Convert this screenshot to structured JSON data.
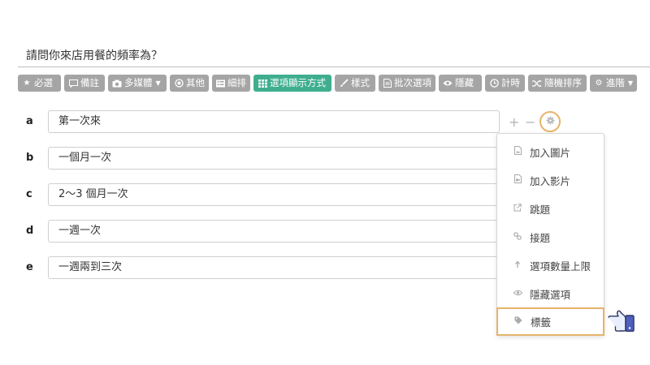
{
  "question": {
    "text": "請問你來店用餐的頻率為？"
  },
  "toolbar": {
    "buttons": [
      {
        "label": "必選",
        "icon": "star-icon"
      },
      {
        "label": "備註",
        "icon": "comment-icon"
      },
      {
        "label": "多媒體",
        "icon": "camera-icon"
      },
      {
        "label": "其他",
        "icon": "radio-icon"
      },
      {
        "label": "細排",
        "icon": "list-icon"
      },
      {
        "label": "選項顯示方式",
        "icon": "grid-icon"
      },
      {
        "label": "樣式",
        "icon": "brush-icon"
      },
      {
        "label": "批次選項",
        "icon": "file-icon"
      },
      {
        "label": "隱藏",
        "icon": "eye-icon"
      },
      {
        "label": "計時",
        "icon": "clock-icon"
      },
      {
        "label": "隨機排序",
        "icon": "shuffle-icon"
      },
      {
        "label": "進階",
        "icon": "gear-icon"
      }
    ],
    "active_color": "#3fae8f",
    "default_color": "#a5a5a5"
  },
  "options": [
    {
      "letter": "a",
      "value": "第一次來"
    },
    {
      "letter": "b",
      "value": "一個月一次"
    },
    {
      "letter": "c",
      "value": "2～3 個月一次"
    },
    {
      "letter": "d",
      "value": "一週一次"
    },
    {
      "letter": "e",
      "value": "一週兩到三次"
    }
  ],
  "row_controls": {
    "plus": "+",
    "minus": "−"
  },
  "dropdown": {
    "items": [
      {
        "label": "加入圖片",
        "icon": "image-file-icon"
      },
      {
        "label": "加入影片",
        "icon": "video-file-icon"
      },
      {
        "label": "跳題",
        "icon": "external-link-icon"
      },
      {
        "label": "接題",
        "icon": "link-icon"
      },
      {
        "label": "選項數量上限",
        "icon": "upload-arrow-icon"
      },
      {
        "label": "隱藏選項",
        "icon": "eye-icon"
      },
      {
        "label": "標籤",
        "icon": "tag-icon"
      }
    ],
    "highlight_color": "#e6b36b"
  }
}
